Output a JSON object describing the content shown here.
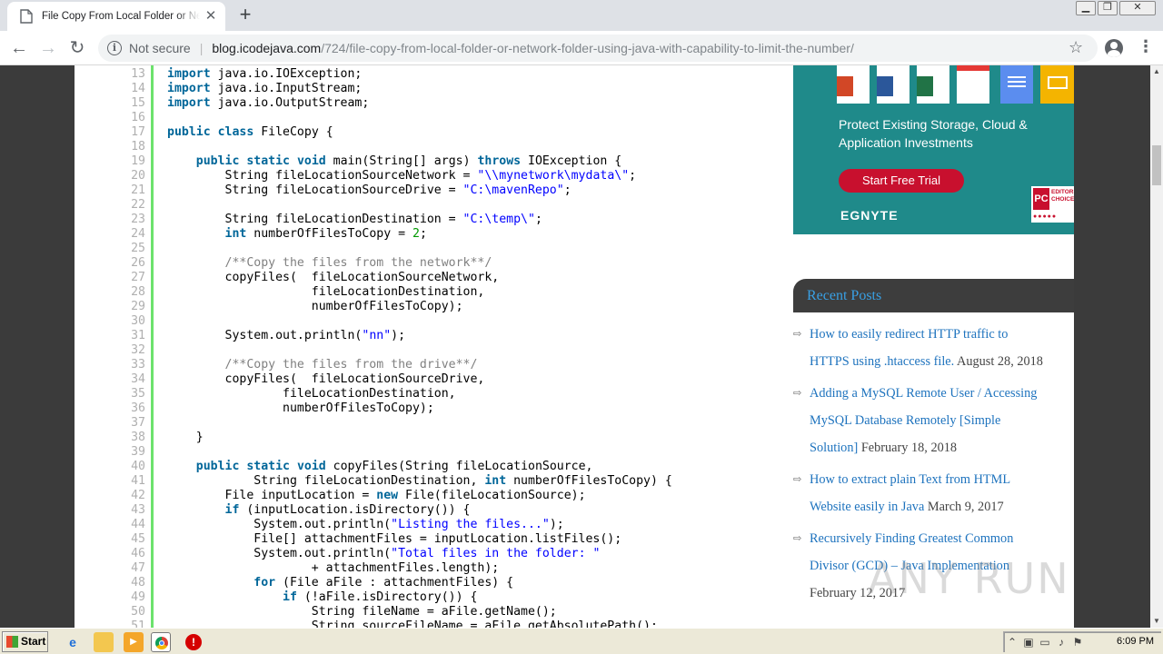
{
  "browser": {
    "tab_title": "File Copy From Local Folder or Network Folder using Java with Capability to Limit the Number",
    "new_tab_label": "+",
    "security_label": "Not secure",
    "url_host": "blog.icodejava.com",
    "url_path": "/724/file-copy-from-local-folder-or-network-folder-using-java-with-capability-to-limit-the-number/"
  },
  "code": {
    "lines": [
      {
        "n": "13",
        "text": "import java.io.IOException;"
      },
      {
        "n": "14",
        "text": "import java.io.InputStream;"
      },
      {
        "n": "15",
        "text": "import java.io.OutputStream;"
      },
      {
        "n": "16",
        "text": ""
      },
      {
        "n": "17",
        "text": "public class FileCopy {"
      },
      {
        "n": "18",
        "text": ""
      },
      {
        "n": "19",
        "text": "    public static void main(String[] args) throws IOException {"
      },
      {
        "n": "20",
        "text": "        String fileLocationSourceNetwork = \"\\\\mynetwork\\mydata\\\";"
      },
      {
        "n": "21",
        "text": "        String fileLocationSourceDrive = \"C:\\mavenRepo\";"
      },
      {
        "n": "22",
        "text": ""
      },
      {
        "n": "23",
        "text": "        String fileLocationDestination = \"C:\\temp\\\";"
      },
      {
        "n": "24",
        "text": "        int numberOfFilesToCopy = 2;"
      },
      {
        "n": "25",
        "text": ""
      },
      {
        "n": "26",
        "text": "        /**Copy the files from the network**/"
      },
      {
        "n": "27",
        "text": "        copyFiles(  fileLocationSourceNetwork,"
      },
      {
        "n": "28",
        "text": "                    fileLocationDestination,"
      },
      {
        "n": "29",
        "text": "                    numberOfFilesToCopy);"
      },
      {
        "n": "30",
        "text": ""
      },
      {
        "n": "31",
        "text": "        System.out.println(\"nn\");"
      },
      {
        "n": "32",
        "text": ""
      },
      {
        "n": "33",
        "text": "        /**Copy the files from the drive**/"
      },
      {
        "n": "34",
        "text": "        copyFiles(  fileLocationSourceDrive,"
      },
      {
        "n": "35",
        "text": "                fileLocationDestination,"
      },
      {
        "n": "36",
        "text": "                numberOfFilesToCopy);"
      },
      {
        "n": "37",
        "text": ""
      },
      {
        "n": "38",
        "text": "    }"
      },
      {
        "n": "39",
        "text": ""
      },
      {
        "n": "40",
        "text": "    public static void copyFiles(String fileLocationSource,"
      },
      {
        "n": "41",
        "text": "            String fileLocationDestination, int numberOfFilesToCopy) {"
      },
      {
        "n": "42",
        "text": "        File inputLocation = new File(fileLocationSource);"
      },
      {
        "n": "43",
        "text": "        if (inputLocation.isDirectory()) {"
      },
      {
        "n": "44",
        "text": "            System.out.println(\"Listing the files...\");"
      },
      {
        "n": "45",
        "text": "            File[] attachmentFiles = inputLocation.listFiles();"
      },
      {
        "n": "46",
        "text": "            System.out.println(\"Total files in the folder: \""
      },
      {
        "n": "47",
        "text": "                    + attachmentFiles.length);"
      },
      {
        "n": "48",
        "text": "            for (File aFile : attachmentFiles) {"
      },
      {
        "n": "49",
        "text": "                if (!aFile.isDirectory()) {"
      },
      {
        "n": "50",
        "text": "                    String fileName = aFile.getName();"
      },
      {
        "n": "51",
        "text": "                    String sourceFileName = aFile.getAbsolutePath();"
      }
    ]
  },
  "ad": {
    "headline": "Protect Existing Storage, Cloud & Application Investments",
    "cta_label": "Start Free Trial",
    "brand": "EGNYTE",
    "badge_pc": "PC",
    "badge_text": "EDITORS' CHOICE"
  },
  "recent_posts": {
    "heading": "Recent Posts",
    "items": [
      {
        "title": "How to easily redirect HTTP traffic to HTTPS using .htaccess file.",
        "date": "August 28, 2018"
      },
      {
        "title": "Adding a MySQL Remote User / Accessing MySQL Database Remotely [Simple Solution]",
        "date": "February 18, 2018"
      },
      {
        "title": "How to extract plain Text from HTML Website easily in Java",
        "date": "March 9, 2017"
      },
      {
        "title": "Recursively Finding Greatest Common Divisor (GCD) – Java Implementation",
        "date": "February 12, 2017"
      }
    ]
  },
  "watermark": "ANY RUN",
  "taskbar": {
    "start_label": "Start",
    "clock": "6:09 PM"
  }
}
